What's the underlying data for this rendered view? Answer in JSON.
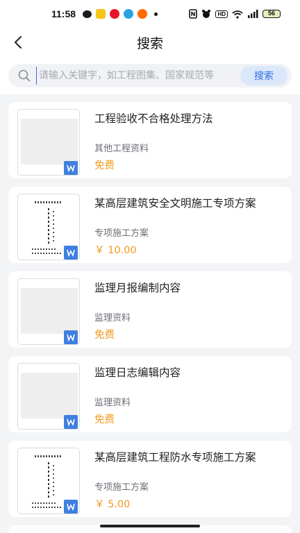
{
  "status_bar": {
    "time": "11:58",
    "battery": "56",
    "hd_label": "HD"
  },
  "header": {
    "title": "搜索",
    "back_icon": "chevron-left-icon"
  },
  "search": {
    "placeholder": "请输入关键字，如工程图集、国家规范等",
    "button_label": "搜索"
  },
  "results": [
    {
      "title": "工程验收不合格处理方法",
      "category": "其他工程资料",
      "price": "免费",
      "thumb": "blank"
    },
    {
      "title": "某高层建筑安全文明施工专项方案",
      "category": "专项施工方案",
      "price": "￥ 10.00",
      "thumb": "doc"
    },
    {
      "title": "监理月报编制内容",
      "category": "监理资料",
      "price": "免费",
      "thumb": "blank"
    },
    {
      "title": "监理日志编辑内容",
      "category": "监理资料",
      "price": "免费",
      "thumb": "blank"
    },
    {
      "title": "某高层建筑工程防水专项施工方案",
      "category": "专项施工方案",
      "price": "￥ 5.00",
      "thumb": "doc"
    }
  ],
  "colors": {
    "accent_blue": "#2f6de0",
    "price_orange": "#f2991f",
    "word_icon_blue": "#3f7fe0"
  }
}
